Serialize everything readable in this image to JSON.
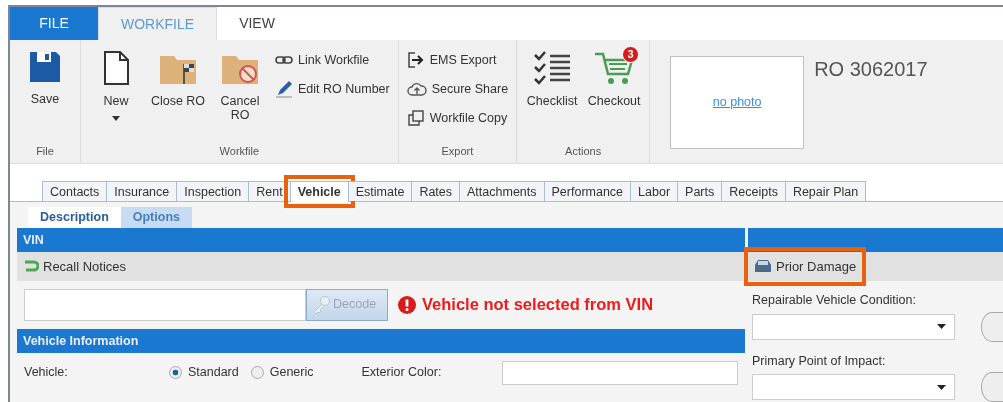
{
  "ribbon_tabs": [
    {
      "label": "FILE",
      "kind": "file",
      "selected": false
    },
    {
      "label": "WORKFILE",
      "kind": "tab",
      "selected": true
    },
    {
      "label": "VIEW",
      "kind": "tab",
      "selected": false
    }
  ],
  "ribbon_groups": [
    {
      "label": "File",
      "items": [
        {
          "label": "Save",
          "kind": "large"
        }
      ]
    },
    {
      "label": "Workfile",
      "items": [
        {
          "label": "New",
          "kind": "large",
          "dropdown": true
        },
        {
          "label": "Close RO",
          "kind": "large"
        },
        {
          "label": "Cancel RO",
          "kind": "large"
        },
        {
          "kind": "stack",
          "items": [
            {
              "label": "Link Workfile"
            },
            {
              "label": "Edit RO Number"
            }
          ]
        }
      ]
    },
    {
      "label": "Export",
      "items": [
        {
          "kind": "stack",
          "items": [
            {
              "label": "EMS Export"
            },
            {
              "label": "Secure Share"
            },
            {
              "label": "Workfile Copy"
            }
          ]
        }
      ]
    },
    {
      "label": "Actions",
      "items": [
        {
          "label": "Checklist",
          "kind": "large"
        },
        {
          "label": "Checkout",
          "kind": "large",
          "badge": "3"
        }
      ]
    }
  ],
  "photo": {
    "link": "no photo"
  },
  "ro_title": "RO 3062017",
  "main_tabs": [
    {
      "label": "Contacts",
      "selected": false,
      "highlighted": false
    },
    {
      "label": "Insurance",
      "selected": false,
      "highlighted": false
    },
    {
      "label": "Inspection",
      "selected": false,
      "highlighted": false
    },
    {
      "label": "Rent",
      "selected": false,
      "highlighted": false
    },
    {
      "label": "Vehicle",
      "selected": true,
      "highlighted": true
    },
    {
      "label": "Estimate",
      "selected": false,
      "highlighted": false
    },
    {
      "label": "Rates",
      "selected": false,
      "highlighted": false
    },
    {
      "label": "Attachments",
      "selected": false,
      "highlighted": false
    },
    {
      "label": "Performance",
      "selected": false,
      "highlighted": false
    },
    {
      "label": "Labor",
      "selected": false,
      "highlighted": false
    },
    {
      "label": "Parts",
      "selected": false,
      "highlighted": false
    },
    {
      "label": "Receipts",
      "selected": false,
      "highlighted": false
    },
    {
      "label": "Repair Plan",
      "selected": false,
      "highlighted": false
    }
  ],
  "sub_tabs": [
    {
      "label": "Description",
      "selected": true
    },
    {
      "label": "Options",
      "selected": false
    }
  ],
  "vin": {
    "header": "VIN",
    "recall": "Recall Notices",
    "decode": "Decode",
    "warning": "Vehicle not selected from VIN"
  },
  "vehicle_info": {
    "header": "Vehicle Information",
    "vehicle_label": "Vehicle:",
    "options": [
      {
        "label": "Standard",
        "selected": true
      },
      {
        "label": "Generic",
        "selected": false
      }
    ],
    "exterior_label": "Exterior Color:"
  },
  "damage": {
    "prior": "Prior Damage",
    "prior_highlighted": true,
    "fields": [
      {
        "label": "Repairable Vehicle Condition:"
      },
      {
        "label": "Primary Point of Impact:"
      }
    ]
  }
}
